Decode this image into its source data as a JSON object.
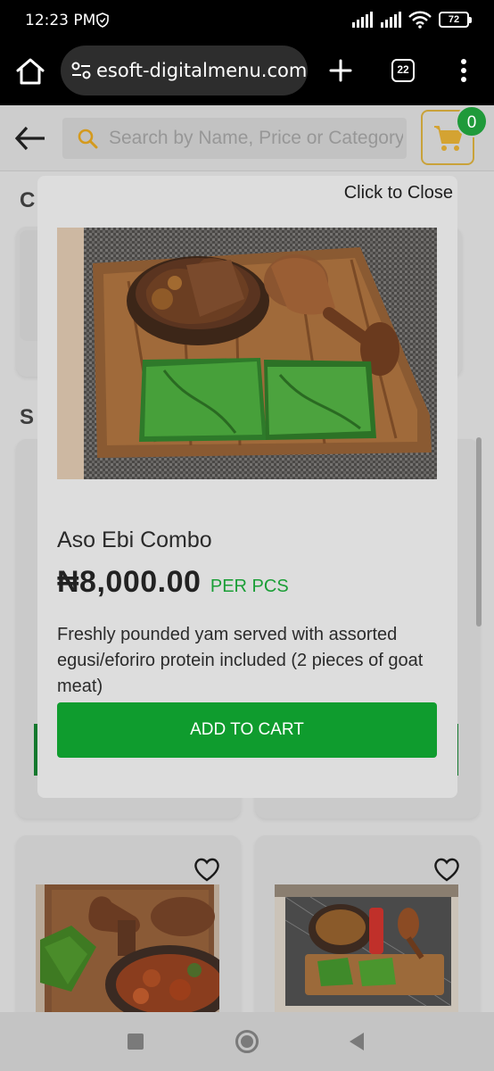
{
  "status_bar": {
    "time": "12:23 PM",
    "battery": "72"
  },
  "browser": {
    "url": "esoft-digitalmenu.com",
    "tab_count": "22"
  },
  "header": {
    "search_placeholder": "Search by Name, Price or Category",
    "cart_count": "0"
  },
  "background": {
    "section_letter_1": "C",
    "section_letter_2": "S"
  },
  "modal": {
    "close_label": "Click to Close",
    "product_name": "Aso Ebi Combo",
    "price": "₦8,000.00",
    "unit": "PER PCS",
    "description": "Freshly pounded yam served with assorted egusi/eforiro protein included (2 pieces of goat meat)",
    "add_to_cart": "ADD TO CART"
  },
  "colors": {
    "accent_green": "#0f9c2e",
    "cart_border": "#c9a23a",
    "badge_green": "#1f9a3a"
  }
}
